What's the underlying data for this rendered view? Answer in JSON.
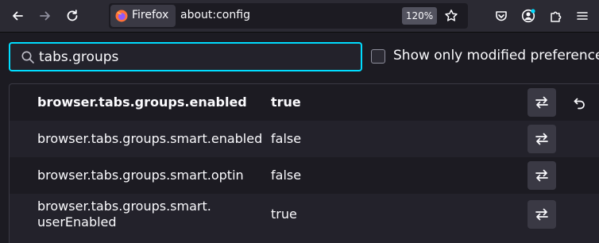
{
  "toolbar": {
    "back_icon": "arrow-left-icon",
    "forward_icon": "arrow-right-icon",
    "reload_icon": "reload-icon",
    "identity_label": "Firefox",
    "url": "about:config",
    "zoom": "120%",
    "bookmark_icon": "star-icon",
    "pocket_icon": "pocket-icon",
    "account_icon": "account-icon",
    "extensions_icon": "puzzle-icon",
    "menu_icon": "hamburger-icon"
  },
  "search": {
    "value": "tabs.groups"
  },
  "filter": {
    "checked": false,
    "label": "Show only modified preferences"
  },
  "prefs": [
    {
      "name": "browser.tabs.groups.enabled",
      "value": "true",
      "modified": true
    },
    {
      "name": "browser.tabs.groups.smart.enabled",
      "value": "false",
      "modified": false
    },
    {
      "name": "browser.tabs.groups.smart.optin",
      "value": "false",
      "modified": false
    },
    {
      "name_line1": "browser.tabs.groups.smart.",
      "name_line2": "userEnabled",
      "value": "true",
      "modified": false
    }
  ],
  "colors": {
    "focus_ring": "#00ddff",
    "accent_dot": "#00ddff",
    "firefox_orange": "#ff7139"
  }
}
